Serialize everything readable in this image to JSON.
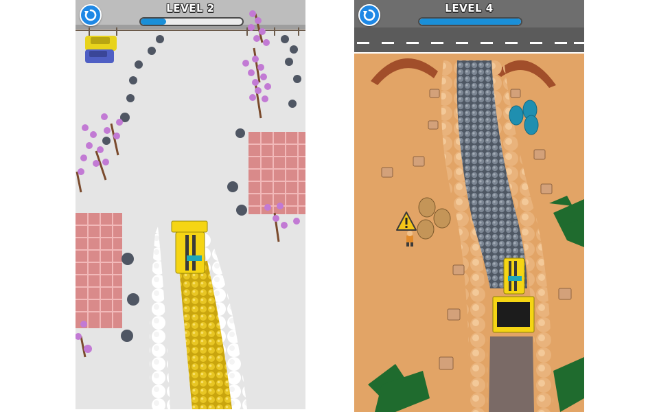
{
  "screens": [
    {
      "level_label": "LEVEL 2",
      "progress": 0.25,
      "icons": {
        "restart": "restart-icon"
      }
    },
    {
      "level_label": "LEVEL 4",
      "progress": 1.0,
      "icons": {
        "restart": "restart-icon",
        "warning": "warning-triangle-icon"
      }
    }
  ],
  "colors": {
    "hud_blue": "#1e88e5",
    "progress_fill": "#1a8fd8",
    "snow": "#e6e6e6",
    "sand": "#e4a468",
    "paver_yellow": "#f5d514"
  }
}
